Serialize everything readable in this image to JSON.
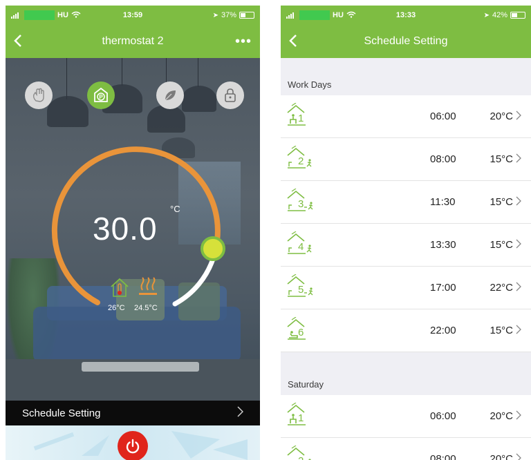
{
  "left": {
    "status": {
      "carrier": "HU",
      "time": "13:59",
      "battery": "37%"
    },
    "nav": {
      "back": "<",
      "title": "thermostat 2",
      "more": "•••"
    },
    "modes": [
      "manual-mode",
      "program-mode",
      "eco-mode",
      "lock"
    ],
    "dial": {
      "setpoint": "30.0",
      "unit": "°C",
      "setpoint_fraction": 0.72
    },
    "readings": {
      "room": "26°C",
      "floor": "24.5°C"
    },
    "schedule_bar": {
      "label": "Schedule Setting",
      "chevron": ">"
    },
    "colors": {
      "accent": "#7ebd42",
      "arc": "#e9943a",
      "power": "#e0251b",
      "knob": "#d6e13a"
    }
  },
  "right": {
    "status": {
      "carrier": "HU",
      "time": "13:33",
      "battery": "42%"
    },
    "nav": {
      "back": "<",
      "title": "Schedule Setting"
    },
    "sections": [
      {
        "title": "Work Days",
        "periods": [
          {
            "n": "1",
            "time": "06:00",
            "temp": "20°C",
            "icon": "wake-icon"
          },
          {
            "n": "2",
            "time": "08:00",
            "temp": "15°C",
            "icon": "leave-icon"
          },
          {
            "n": "3",
            "time": "11:30",
            "temp": "15°C",
            "icon": "return-icon"
          },
          {
            "n": "4",
            "time": "13:30",
            "temp": "15°C",
            "icon": "leave-icon"
          },
          {
            "n": "5",
            "time": "17:00",
            "temp": "22°C",
            "icon": "return-icon"
          },
          {
            "n": "6",
            "time": "22:00",
            "temp": "15°C",
            "icon": "sleep-icon"
          }
        ]
      },
      {
        "title": "Saturday",
        "periods": [
          {
            "n": "1",
            "time": "06:00",
            "temp": "20°C",
            "icon": "wake-icon"
          },
          {
            "n": "2",
            "time": "08:00",
            "temp": "20°C",
            "icon": "leave-icon"
          }
        ]
      }
    ],
    "chevron": ">"
  }
}
